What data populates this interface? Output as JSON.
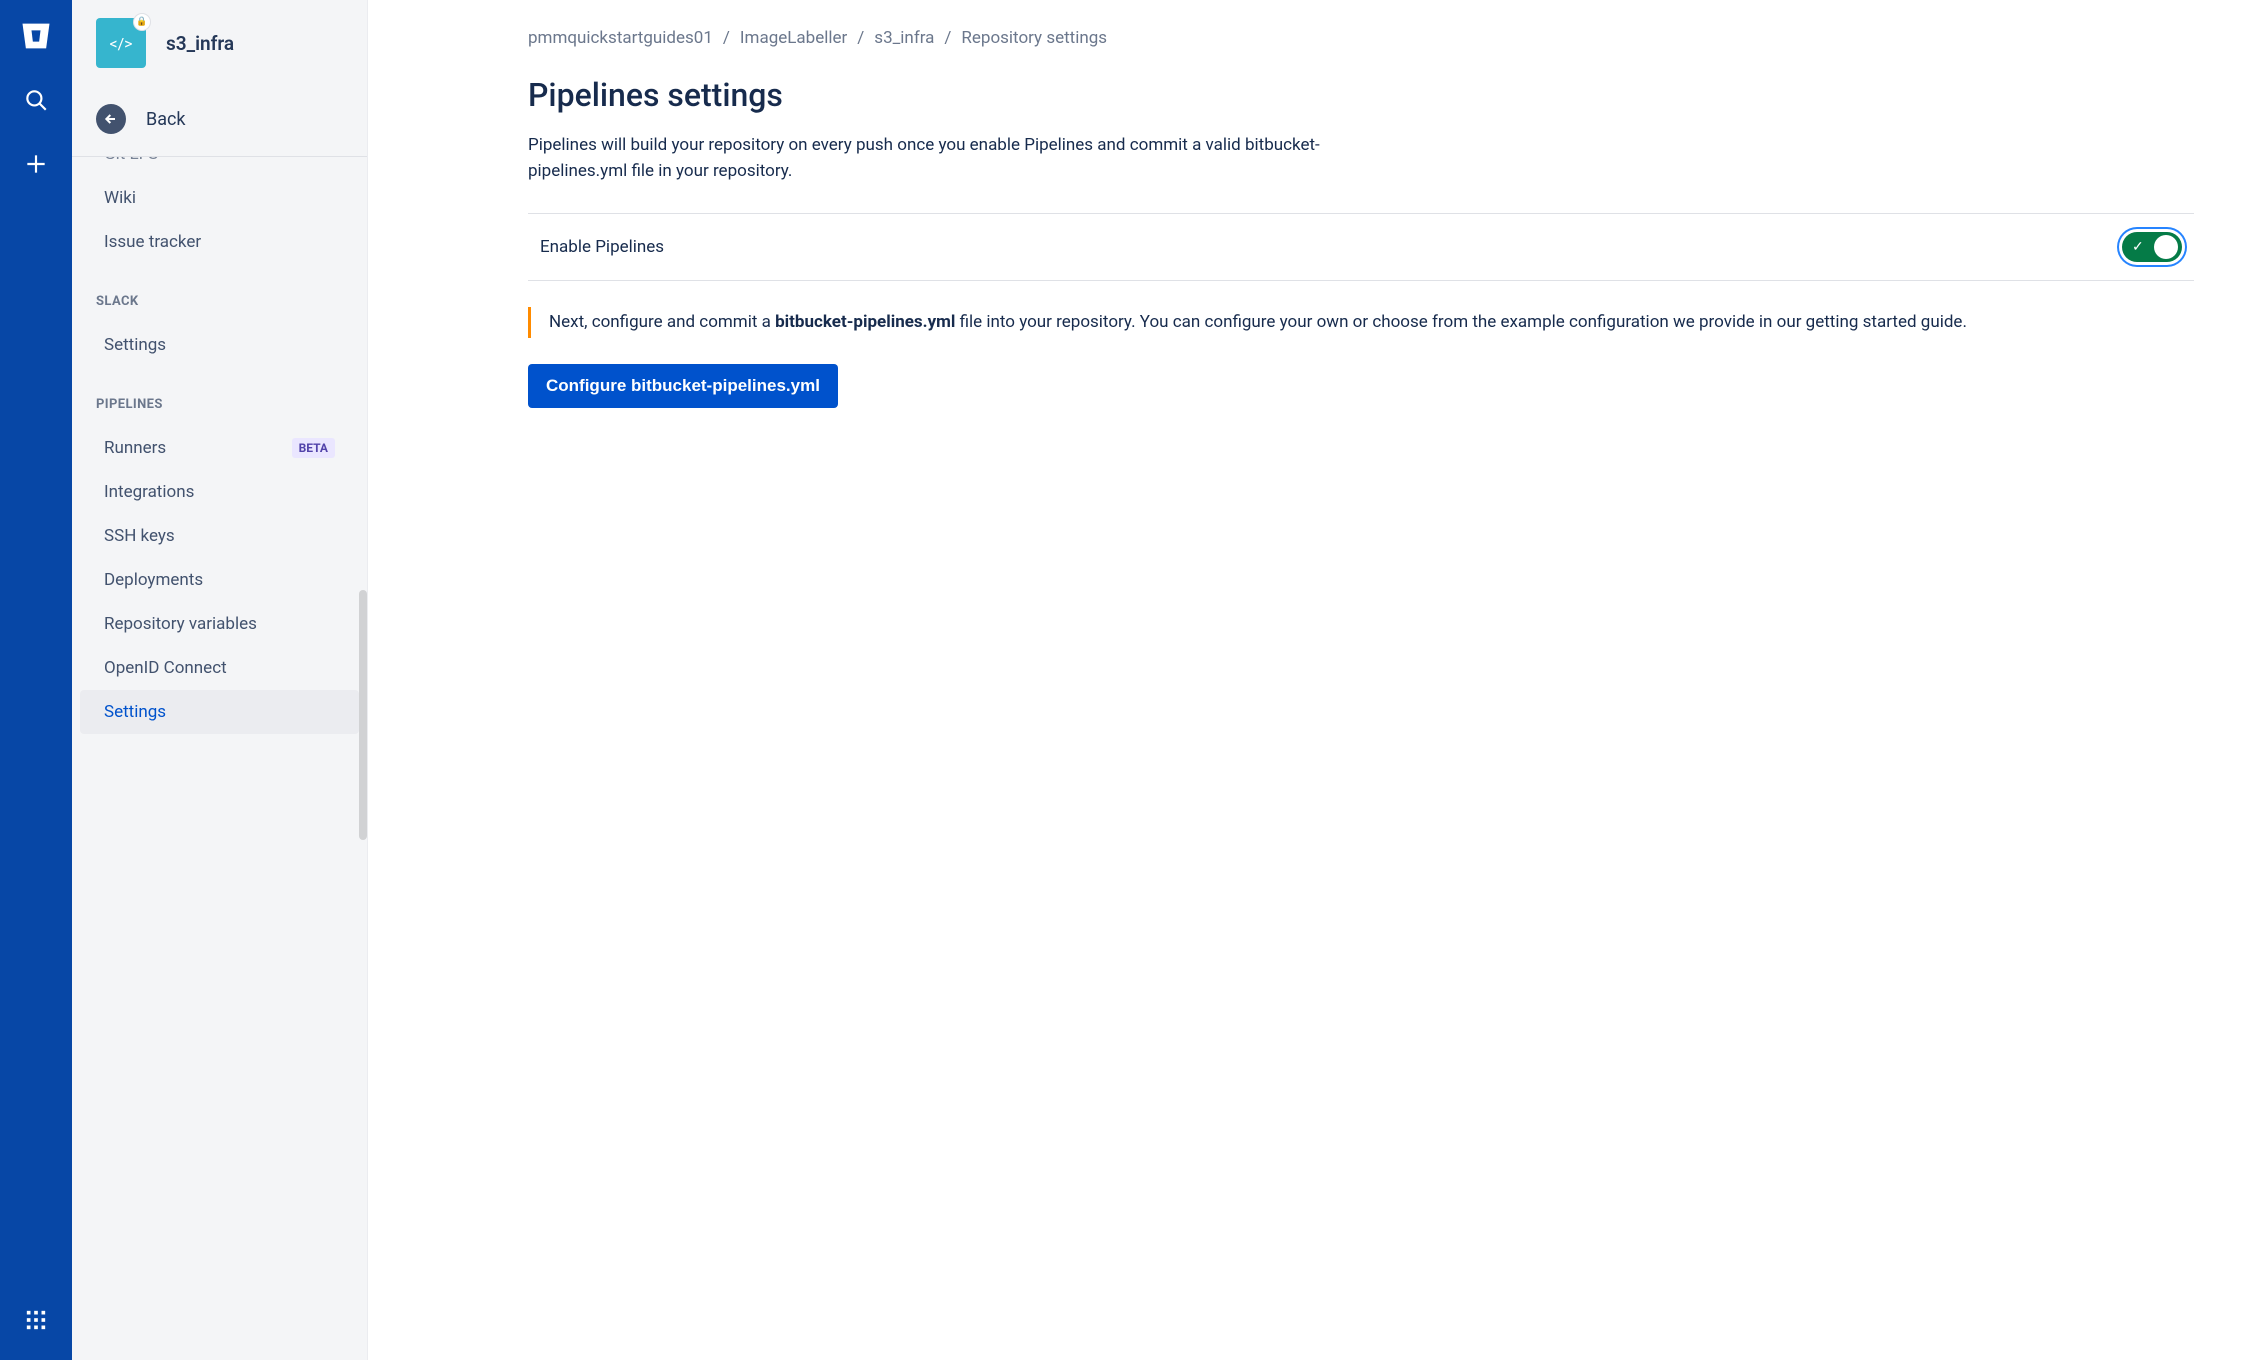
{
  "rail": {
    "logo": "bitbucket",
    "search": "search-icon",
    "add": "plus-icon",
    "apps": "apps-icon"
  },
  "repo": {
    "name": "s3_infra",
    "avatar_glyph": "</>"
  },
  "back": {
    "label": "Back"
  },
  "sidebar": {
    "partial_top": "Git LFS",
    "items_top": [
      "Wiki",
      "Issue tracker"
    ],
    "section_slack": "SLACK",
    "items_slack": [
      "Settings"
    ],
    "section_pipelines": "PIPELINES",
    "items_pipelines": [
      {
        "label": "Runners",
        "badge": "BETA"
      },
      {
        "label": "Integrations"
      },
      {
        "label": "SSH keys"
      },
      {
        "label": "Deployments"
      },
      {
        "label": "Repository variables"
      },
      {
        "label": "OpenID Connect"
      },
      {
        "label": "Settings",
        "active": true
      }
    ]
  },
  "breadcrumb": [
    "pmmquickstartguides01",
    "ImageLabeller",
    "s3_infra",
    "Repository settings"
  ],
  "page": {
    "title": "Pipelines settings",
    "lead": "Pipelines will build your repository on every push once you enable Pipelines and commit a valid bitbucket-pipelines.yml file in your repository.",
    "toggle_label": "Enable Pipelines",
    "toggle_on": true,
    "callout_pre": "Next, configure and commit a ",
    "callout_bold": "bitbucket-pipelines.yml",
    "callout_post": " file into your repository. You can configure your own or choose from the example configuration we provide in our getting started guide.",
    "button": "Configure bitbucket-pipelines.yml"
  }
}
